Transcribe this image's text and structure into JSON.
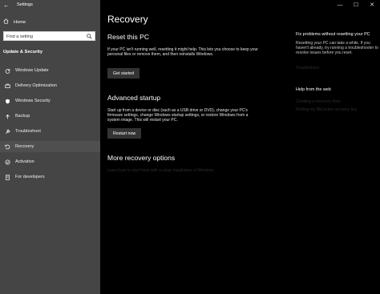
{
  "window": {
    "title": "Settings",
    "back": "←",
    "minimize": "—",
    "maximize": "☐",
    "close": "✕"
  },
  "sidebar": {
    "home_label": "Home",
    "search_placeholder": "Find a setting",
    "section_title": "Update & Security",
    "items": [
      {
        "label": "Windows Update",
        "icon": "sync-icon"
      },
      {
        "label": "Delivery Optimization",
        "icon": "delivery-icon"
      },
      {
        "label": "Windows Security",
        "icon": "shield-icon"
      },
      {
        "label": "Backup",
        "icon": "backup-icon"
      },
      {
        "label": "Troubleshoot",
        "icon": "wrench-icon"
      },
      {
        "label": "Recovery",
        "icon": "recovery-icon"
      },
      {
        "label": "Activation",
        "icon": "check-circle-icon"
      },
      {
        "label": "For developers",
        "icon": "developer-icon"
      }
    ]
  },
  "main": {
    "page_title": "Recovery",
    "reset": {
      "heading": "Reset this PC",
      "description": "If your PC isn't running well, resetting it might help. This lets you choose to keep your personal files or remove them, and then reinstalls Windows.",
      "button": "Get started"
    },
    "advanced": {
      "heading": "Advanced startup",
      "description": "Start up from a device or disc (such as a USB drive or DVD), change your PC's firmware settings, change Windows startup settings, or restore Windows from a system image. This will restart your PC.",
      "button": "Restart now"
    },
    "more": {
      "heading": "More recovery options",
      "link": "Learn how to start fresh with a clean installation of Windows"
    }
  },
  "right_panel": {
    "fix_heading": "Fix problems without resetting your PC",
    "fix_text": "Resetting your PC can take a while. If you haven't already, try running a troubleshooter to resolve issues before you reset.",
    "fix_link": "Troubleshoot",
    "help_heading": "Help from the web",
    "help_links": [
      "Creating a recovery drive",
      "Finding my BitLocker recovery key"
    ]
  }
}
